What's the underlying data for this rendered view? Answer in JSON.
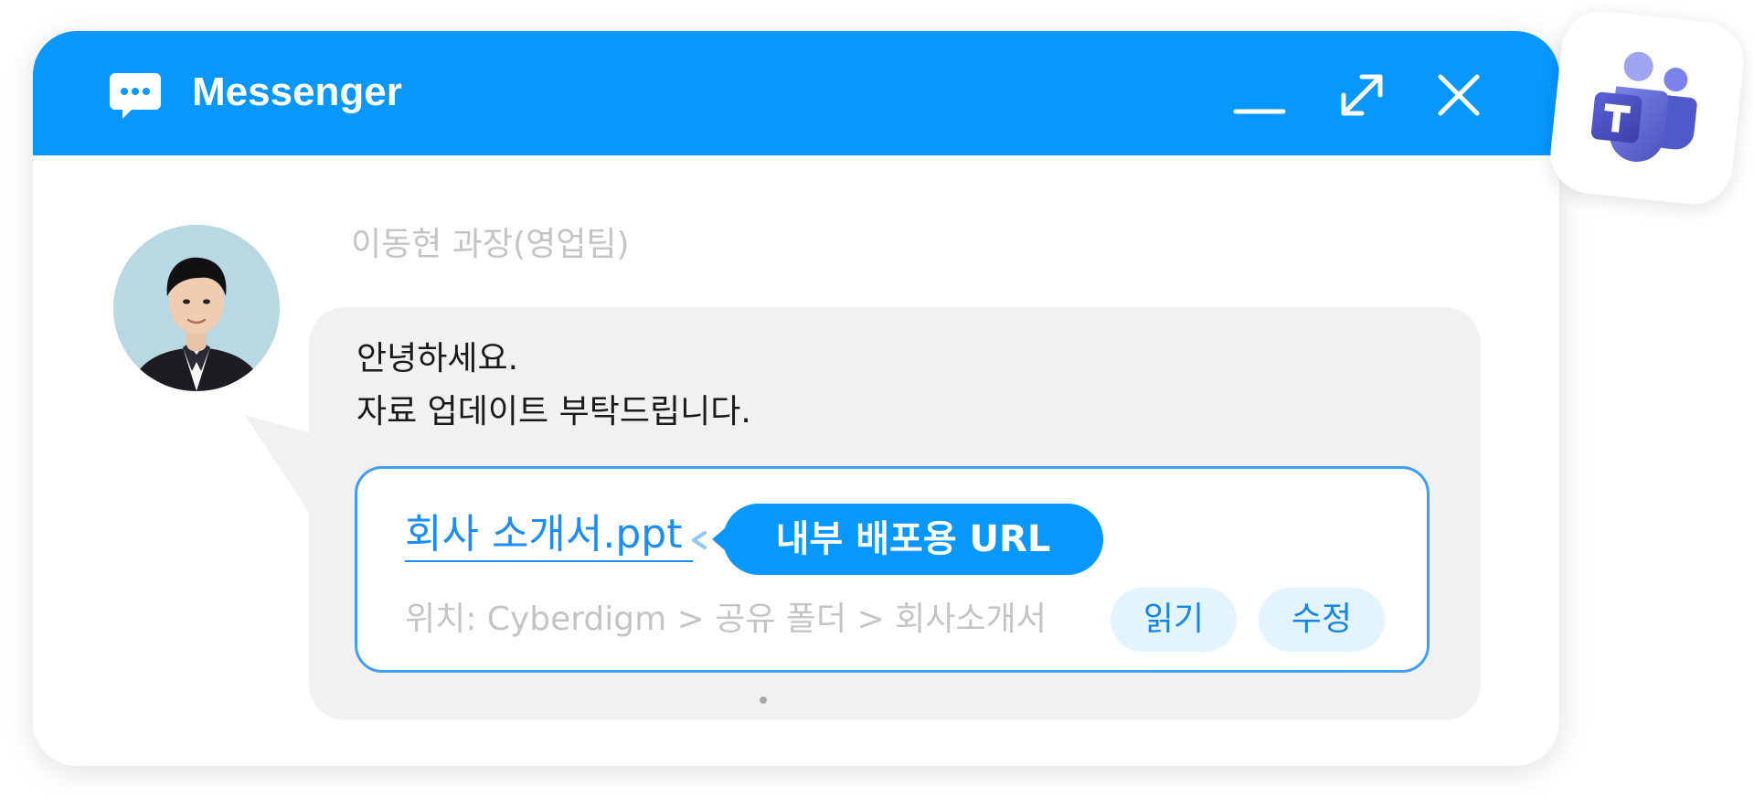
{
  "window": {
    "title": "Messenger",
    "title_icon": "chat-bubble-icon",
    "controls": {
      "minimize_icon": "minimize-icon",
      "maximize_icon": "expand-icon",
      "close_icon": "close-icon"
    }
  },
  "message": {
    "sender": "이동현 과장(영업팀)",
    "lines": [
      "안녕하세요.",
      "자료 업데이트 부탁드립니다."
    ],
    "attachment": {
      "file_name": "회사 소개서.ppt",
      "badge": "내부 배포용 URL",
      "location": "위치: Cyberdigm > 공유 폴더 > 회사소개서",
      "actions": {
        "read": "읽기",
        "edit": "수정"
      }
    }
  },
  "integration": {
    "icon": "microsoft-teams-icon"
  },
  "colors": {
    "accent": "#0797fd",
    "link": "#1a8df8",
    "bubble_bg": "#f1f1f1",
    "pill_bg": "#e3f4fd",
    "muted_text": "#c4c4c4"
  }
}
